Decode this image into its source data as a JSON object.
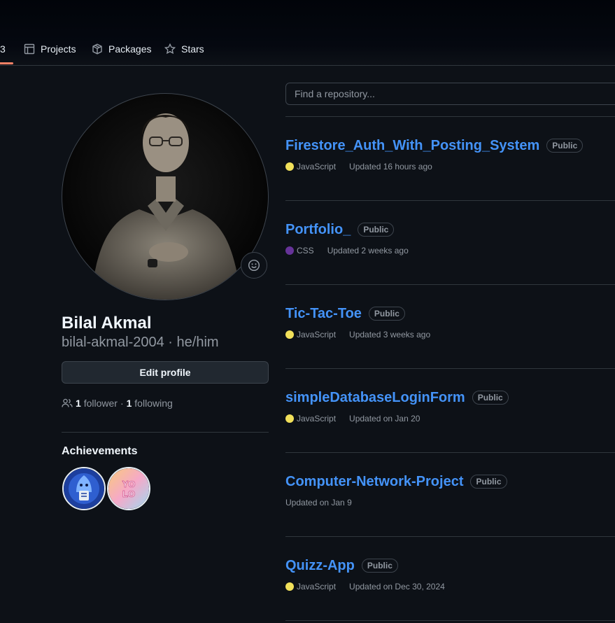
{
  "nav": {
    "partial_tab_count": "3",
    "tabs": [
      {
        "label": "Projects",
        "icon": "table-icon"
      },
      {
        "label": "Packages",
        "icon": "package-icon"
      },
      {
        "label": "Stars",
        "icon": "star-icon"
      }
    ]
  },
  "profile": {
    "name": "Bilal Akmal",
    "login_line": "bilal-akmal-2004 · he/him",
    "edit_label": "Edit profile",
    "followers_count": "1",
    "followers_label": "follower",
    "separator": "·",
    "following_count": "1",
    "following_label": "following",
    "achievements_title": "Achievements",
    "achievements": [
      {
        "name": "Pull Shark",
        "color": "#2f5fd0"
      },
      {
        "name": "YOLO",
        "color": "#f5a9c8"
      }
    ]
  },
  "search": {
    "placeholder": "Find a repository..."
  },
  "repos": [
    {
      "name": "Firestore_Auth_With_Posting_System",
      "visibility": "Public",
      "language": "JavaScript",
      "language_color": "#f1e05a",
      "updated": "Updated 16 hours ago"
    },
    {
      "name": "Portfolio_",
      "visibility": "Public",
      "language": "CSS",
      "language_color": "#663399",
      "updated": "Updated 2 weeks ago"
    },
    {
      "name": "Tic-Tac-Toe",
      "visibility": "Public",
      "language": "JavaScript",
      "language_color": "#f1e05a",
      "updated": "Updated 3 weeks ago"
    },
    {
      "name": "simpleDatabaseLoginForm",
      "visibility": "Public",
      "language": "JavaScript",
      "language_color": "#f1e05a",
      "updated": "Updated on Jan 20"
    },
    {
      "name": "Computer-Network-Project",
      "visibility": "Public",
      "language": "",
      "language_color": "",
      "updated": "Updated on Jan 9"
    },
    {
      "name": "Quizz-App",
      "visibility": "Public",
      "language": "JavaScript",
      "language_color": "#f1e05a",
      "updated": "Updated on Dec 30, 2024"
    }
  ],
  "colors": {
    "link": "#4493f8",
    "tab_underline": "#f78166",
    "background": "#0d1117"
  }
}
